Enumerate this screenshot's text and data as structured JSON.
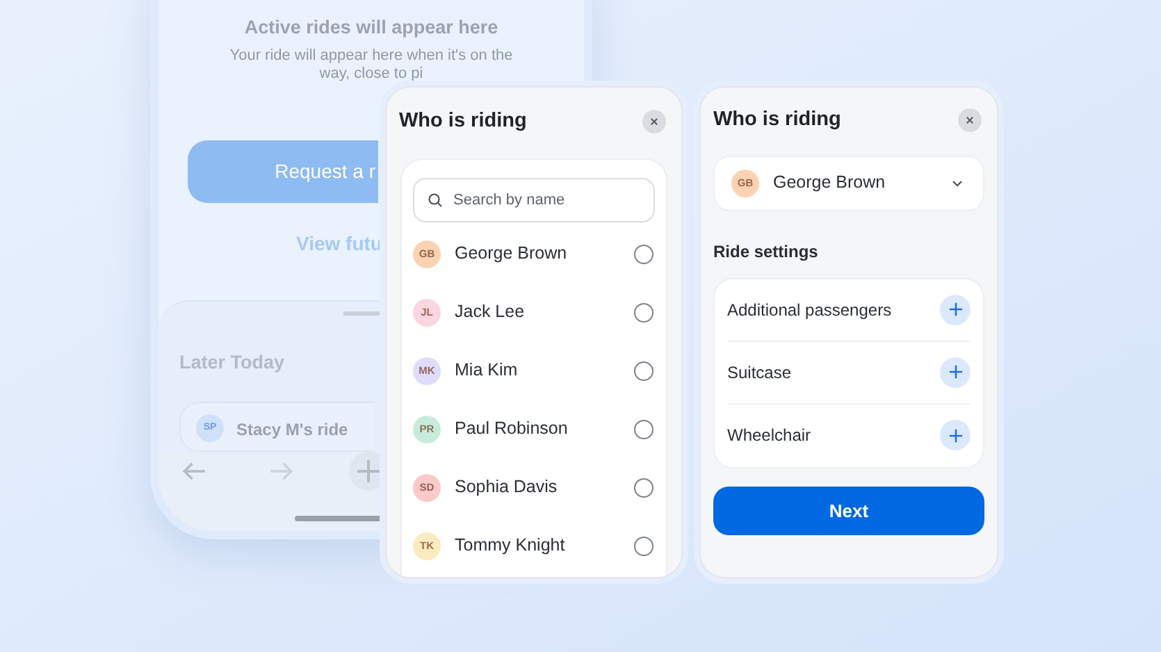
{
  "background_phone": {
    "empty_title": "Active rides will appear here",
    "empty_message": "Your ride will appear here when it's on the way, close to pi",
    "request_button": "Request a r",
    "future_link": "View futu",
    "later_title": "Later Today",
    "ride": {
      "initials": "SP",
      "name": "Stacy M's ride"
    }
  },
  "rider_list_panel": {
    "title": "Who is riding",
    "search": {
      "placeholder": "Search by name"
    },
    "people": [
      {
        "initials": "GB",
        "name": "George Brown",
        "color": "#fbd3b4",
        "selected": false
      },
      {
        "initials": "JL",
        "name": "Jack Lee",
        "color": "#fbd5df",
        "selected": false
      },
      {
        "initials": "MK",
        "name": "Mia Kim",
        "color": "#e0dcfb",
        "selected": false
      },
      {
        "initials": "PR",
        "name": "Paul Robinson",
        "color": "#c8ecdc",
        "selected": false
      },
      {
        "initials": "SD",
        "name": "Sophia Davis",
        "color": "#fbc9c9",
        "selected": false
      },
      {
        "initials": "TK",
        "name": "Tommy Knight",
        "color": "#fcebc0",
        "selected": false
      }
    ]
  },
  "ride_settings_panel": {
    "title": "Who is riding",
    "rider": {
      "initials": "GB",
      "name": "George Brown",
      "color": "#fbd3b4"
    },
    "section_title": "Ride settings",
    "settings": [
      {
        "label": "Additional passengers"
      },
      {
        "label": "Suitcase"
      },
      {
        "label": "Wheelchair"
      }
    ],
    "next_button": "Next"
  }
}
